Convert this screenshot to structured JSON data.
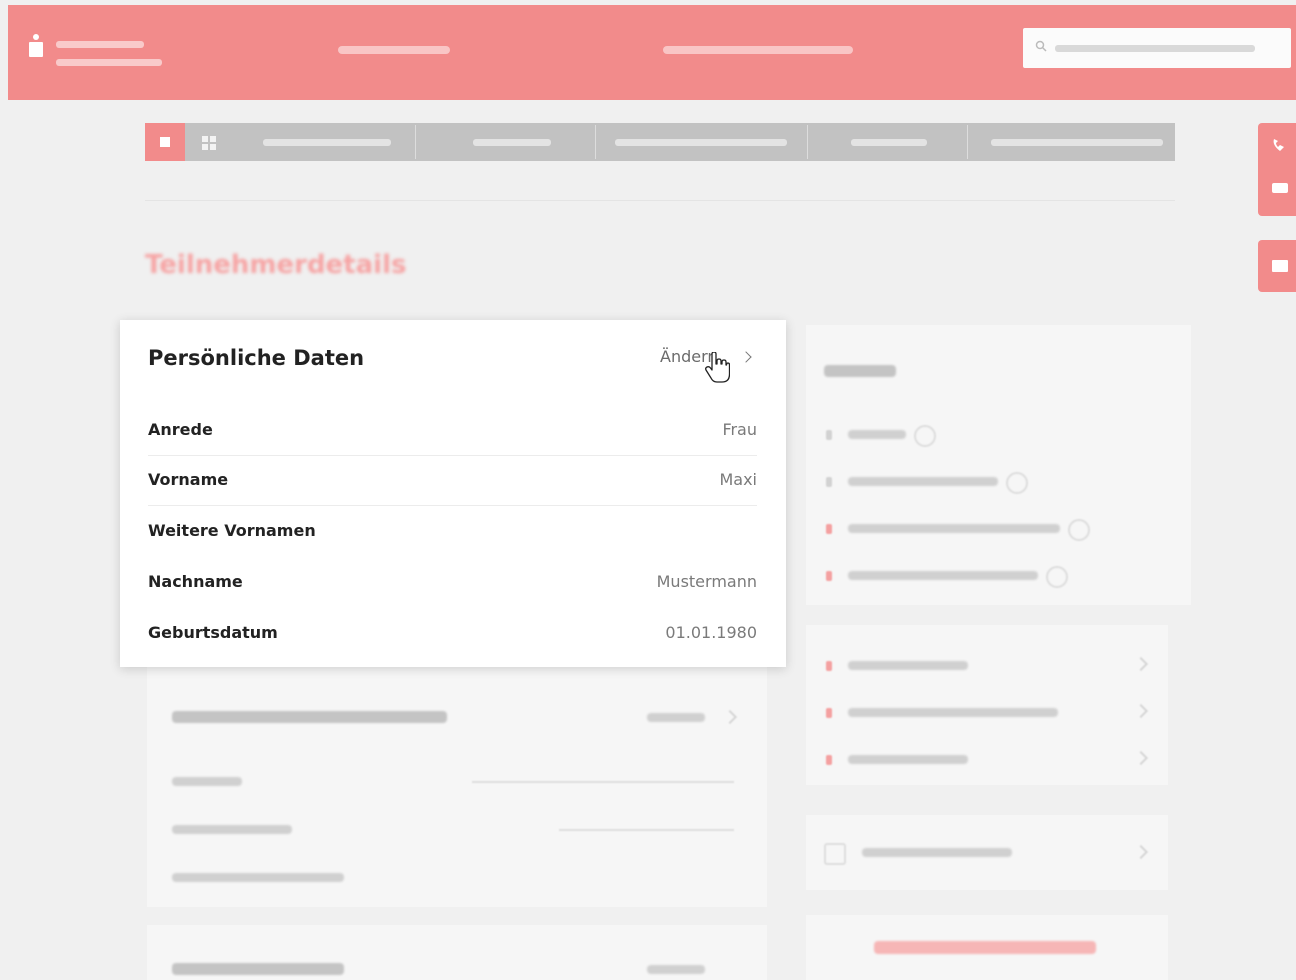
{
  "card": {
    "title": "Persönliche Daten",
    "action_label": "Ändern",
    "rows": [
      {
        "label": "Anrede",
        "value": "Frau"
      },
      {
        "label": "Vorname",
        "value": "Maxi"
      },
      {
        "label": "Weitere Vornamen",
        "value": ""
      },
      {
        "label": "Nachname",
        "value": "Mustermann"
      },
      {
        "label": "Geburtsdatum",
        "value": "01.01.1980"
      }
    ]
  },
  "icons": {
    "logo": "sparkasse-logo-icon",
    "search": "search-icon",
    "home": "home-icon",
    "grid": "grid-icon",
    "phone": "phone-icon",
    "chat": "chat-icon",
    "mail": "mail-icon",
    "chevron": "chevron-right-icon",
    "cursor": "hand-cursor-icon"
  },
  "colors": {
    "brand": "#f28b8b",
    "title_text": "#222222",
    "value_text": "#7a7a7a"
  }
}
